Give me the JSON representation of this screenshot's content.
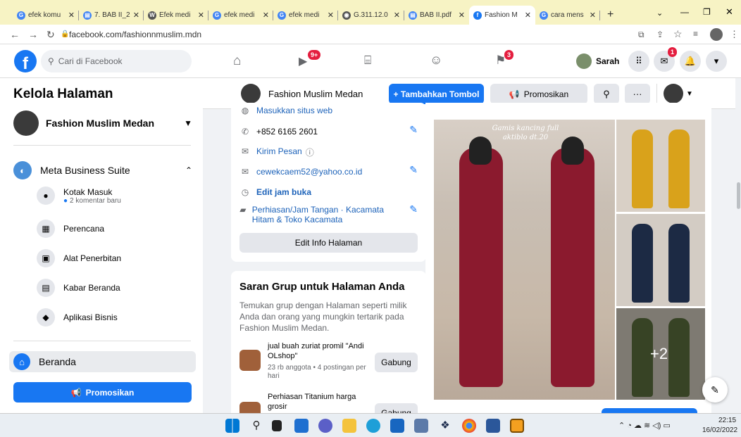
{
  "browser": {
    "tabs": [
      {
        "label": "efek komu",
        "color": "#4285f4",
        "icon": "google-icon",
        "glyph": "G"
      },
      {
        "label": "7. BAB II_2",
        "color": "#4285f4",
        "icon": "docs-icon",
        "glyph": "▤"
      },
      {
        "label": "Efek medi",
        "color": "#555555",
        "icon": "wikipedia-icon",
        "glyph": "W"
      },
      {
        "label": "efek medi",
        "color": "#4285f4",
        "icon": "google-icon",
        "glyph": "G"
      },
      {
        "label": "efek medi",
        "color": "#4285f4",
        "icon": "google-icon",
        "glyph": "G"
      },
      {
        "label": "G.311.12.0",
        "color": "#555555",
        "icon": "globe-icon",
        "glyph": "◉"
      },
      {
        "label": "BAB II.pdf",
        "color": "#4285f4",
        "icon": "docs-icon",
        "glyph": "▤"
      },
      {
        "label": "Fashion M",
        "color": "#1877f2",
        "icon": "facebook-icon",
        "glyph": "f"
      },
      {
        "label": "cara mens",
        "color": "#4285f4",
        "icon": "google-icon",
        "glyph": "G"
      }
    ],
    "new_tab": "+",
    "url": "facebook.com/fashionnmuslim.mdn"
  },
  "fb": {
    "search_placeholder": "Cari di Facebook",
    "watch_badge": "9+",
    "pages_badge": "3",
    "messenger_badge": "1",
    "user_name": "Sarah",
    "accent": "#1877f2"
  },
  "sidebar": {
    "title": "Kelola Halaman",
    "page_name": "Fashion Muslim Medan",
    "business_suite": "Meta Business Suite",
    "items": [
      {
        "label": "Kotak Masuk",
        "sub": "2 komentar baru",
        "icon": "inbox-icon",
        "glyph": "●"
      },
      {
        "label": "Perencana",
        "sub": "",
        "icon": "planner-icon",
        "glyph": "▦"
      },
      {
        "label": "Alat Penerbitan",
        "sub": "",
        "icon": "publishing-tools-icon",
        "glyph": "▣"
      },
      {
        "label": "Kabar Beranda",
        "sub": "",
        "icon": "news-feed-icon",
        "glyph": "▤"
      },
      {
        "label": "Aplikasi Bisnis",
        "sub": "",
        "icon": "business-apps-icon",
        "glyph": "◆"
      }
    ],
    "home_label": "Beranda",
    "promote_label": "Promosikan"
  },
  "pagebar": {
    "page_name": "Fashion Muslim Medan",
    "add_button": "+ Tambahkan Tombol",
    "promote": "Promosikan"
  },
  "about": {
    "website": "Masukkan situs web",
    "phone": "+852 6165 2601",
    "message": "Kirim Pesan",
    "email": "cewekcaem52@yahoo.co.id",
    "hours": "Edit jam buka",
    "category": "Perhiasan/Jam Tangan · Kacamata Hitam & Toko Kacamata",
    "edit_info": "Edit Info Halaman"
  },
  "groups": {
    "title": "Saran Grup untuk Halaman Anda",
    "desc": "Temukan grup dengan Halaman seperti milik Anda dan orang yang mungkin tertarik pada Fashion Muslim Medan.",
    "items": [
      {
        "name": "jual buah zuriat promil \"Andi OLshop\"",
        "meta": "23 rb anggota • 4 postingan per hari",
        "action": "Gabung"
      },
      {
        "name": "Perhiasan Titanium harga grosir",
        "meta": "",
        "action": "Gabung"
      }
    ]
  },
  "post": {
    "caption": "Gamis kancing full aktiblo dt.20",
    "more_count": "+2"
  },
  "taskbar": {
    "time": "22:15",
    "date": "16/02/2022"
  }
}
